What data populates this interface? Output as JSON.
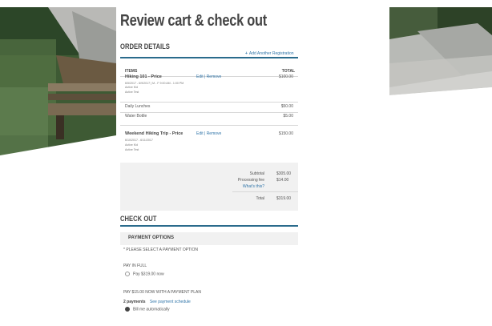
{
  "page": {
    "title": "Review cart & check out"
  },
  "order": {
    "heading": "ORDER DETAILS",
    "add_link": "Add Another Registration",
    "col_items": "ITEMS",
    "col_total": "TOTAL",
    "items": [
      {
        "name": "Hiking 101 - Price",
        "links": "Edit | Remove",
        "price": "$100.00",
        "details": [
          "6/5/2017 - 6/9/2017 | M - F 9:00 AM - 1:00 PM",
          "Active Kid",
          "Active Test"
        ]
      },
      {
        "name": "Weekend Hiking Trip - Price",
        "links": "Edit | Remove",
        "price": "$150.00",
        "details": [
          "6/10/2017 - 6/11/2017",
          "Active Kid",
          "Active Test"
        ]
      }
    ],
    "addons": [
      {
        "label": "Daily Lunches",
        "price": "$50.00"
      },
      {
        "label": "Water Bottle",
        "price": "$5.00"
      }
    ]
  },
  "summary": {
    "subtotal_label": "Subtotal",
    "subtotal": "$305.00",
    "fee_label": "Processing fee",
    "fee": "$14.00",
    "whats_this": "What's this?",
    "total_label": "Total",
    "total": "$319.00"
  },
  "checkout": {
    "heading": "CHECK OUT",
    "payment_options": "PAYMENT OPTIONS",
    "select_prompt": "* PLEASE SELECT A PAYMENT OPTION",
    "pay_full_heading": "PAY IN FULL",
    "pay_full_option": "Pay $319.00 now",
    "plan_heading": "PAY $15.00 NOW WITH A PAYMENT PLAN",
    "plan_payments": "2 payments",
    "plan_link": "See payment schedule",
    "bill_auto": "Bill me automatically"
  },
  "colors": {
    "accent": "#2a6b8c",
    "link": "#2f74a8"
  }
}
